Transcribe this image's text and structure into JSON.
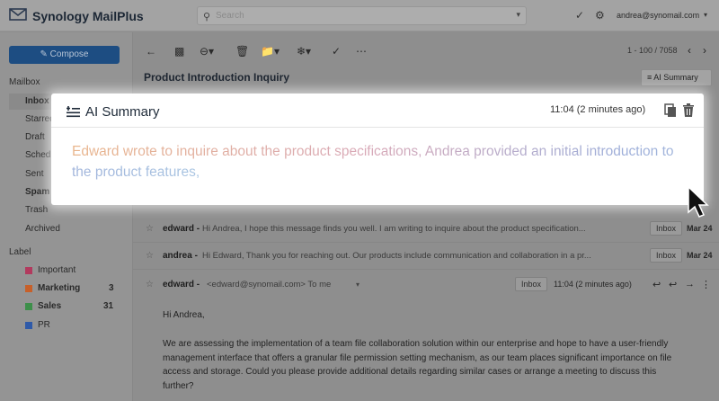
{
  "app": {
    "title": "Synology MailPlus"
  },
  "search": {
    "placeholder": "Search"
  },
  "account": {
    "email": "andrea@synomail.com"
  },
  "sidebar": {
    "compose_label": "Compose",
    "mailbox_header": "Mailbox",
    "items": [
      {
        "label": "Inbox",
        "bold": true
      },
      {
        "label": "Starred",
        "bold": false
      },
      {
        "label": "Draft",
        "bold": false
      },
      {
        "label": "Scheduled",
        "bold": false
      },
      {
        "label": "Sent",
        "bold": false
      },
      {
        "label": "Spam",
        "bold": true
      },
      {
        "label": "Trash",
        "bold": false
      },
      {
        "label": "Archived",
        "bold": false
      }
    ],
    "label_header": "Label",
    "labels": [
      {
        "name": "Important",
        "color": "#b23a5e",
        "count": ""
      },
      {
        "name": "Marketing",
        "color": "#c7602a",
        "count": "3"
      },
      {
        "name": "Sales",
        "color": "#3d8f4a",
        "count": "31"
      },
      {
        "name": "PR",
        "color": "#2f5aa8",
        "count": ""
      }
    ]
  },
  "toolbar": {
    "pager": "1 - 100 / 7058"
  },
  "thread": {
    "subject": "Product Introduction Inquiry",
    "ai_summary_button": "AI Summary",
    "rows": [
      {
        "from": "edward -",
        "snippet": "Hi Andrea, I hope this message finds you well. I am writing to inquire about the product specification...",
        "tag": "Inbox",
        "date": "Mar 24"
      },
      {
        "from": "andrea -",
        "snippet": "Hi Edward, Thank you for reaching out. Our products include communication and collaboration in a pr...",
        "tag": "Inbox",
        "date": "Mar 24"
      }
    ],
    "open_message": {
      "from": "edward -",
      "address": "<edward@synomail.com> To me",
      "tag": "Inbox",
      "time": "11:04 (2 minutes ago)",
      "greeting": "Hi Andrea,",
      "body": "We are assessing the implementation of a team file collaboration solution within our enterprise and hope to have a user-friendly management interface that offers a granular file permission setting mechanism, as our team places significant importance on file access and storage. Could you please provide additional details regarding similar cases or arrange a meeting to discuss this further?"
    }
  },
  "ai_summary": {
    "title": "AI Summary",
    "time": "11:04 (2 minutes ago)",
    "text": "Edward wrote to inquire about the product specifications, Andrea provided an initial introduction to the product features,"
  },
  "colors": {
    "compose": "#1d4d82",
    "modal_bg": "#ffffff"
  }
}
